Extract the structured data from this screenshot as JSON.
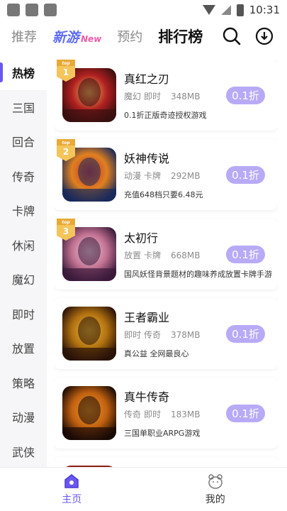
{
  "status_bar": {
    "time": "10:31"
  },
  "header": {
    "tabs": [
      {
        "label": "推荐"
      },
      {
        "label": "新游",
        "badge": "New"
      },
      {
        "label": "预约"
      },
      {
        "label": "排行榜"
      }
    ],
    "active_tab": "排行榜",
    "icons": [
      "search-icon",
      "download-icon"
    ]
  },
  "sidebar": {
    "items": [
      {
        "label": "热榜"
      },
      {
        "label": "三国"
      },
      {
        "label": "回合"
      },
      {
        "label": "传奇"
      },
      {
        "label": "卡牌"
      },
      {
        "label": "休闲"
      },
      {
        "label": "魔幻"
      },
      {
        "label": "即时"
      },
      {
        "label": "放置"
      },
      {
        "label": "策略"
      },
      {
        "label": "动漫"
      },
      {
        "label": "武侠"
      }
    ],
    "active": "热榜"
  },
  "games": [
    {
      "rank_label": "top",
      "rank": "1",
      "title": "真红之刃",
      "tags": [
        "魔幻",
        "即时"
      ],
      "size": "348MB",
      "desc": "0.1折正版奇迹授权游戏",
      "discount": "0.1折"
    },
    {
      "rank_label": "top",
      "rank": "2",
      "title": "妖神传说",
      "tags": [
        "动漫",
        "卡牌"
      ],
      "size": "292MB",
      "desc": "充值648档只要6.48元",
      "discount": "0.1折"
    },
    {
      "rank_label": "top",
      "rank": "3",
      "title": "太初行",
      "tags": [
        "放置",
        "卡牌"
      ],
      "size": "668MB",
      "desc": "国风妖怪背景题材的趣味养成放置卡牌手游",
      "discount": "0.1折"
    },
    {
      "title": "王者霸业",
      "tags": [
        "即时",
        "传奇"
      ],
      "size": "378MB",
      "desc": "真公益 全网最良心",
      "discount": "0.1折"
    },
    {
      "title": "真牛传奇",
      "tags": [
        "传奇",
        "即时"
      ],
      "size": "183MB",
      "desc": "三国单职业ARPG游戏",
      "discount": "0.1折"
    }
  ],
  "bottom_nav": {
    "items": [
      {
        "label": "主页",
        "icon": "home-icon"
      },
      {
        "label": "我的",
        "icon": "bear-icon"
      }
    ],
    "active": "主页"
  },
  "colors": {
    "accent": "#6a57f0",
    "discount_bg": "#b8aaf6"
  }
}
